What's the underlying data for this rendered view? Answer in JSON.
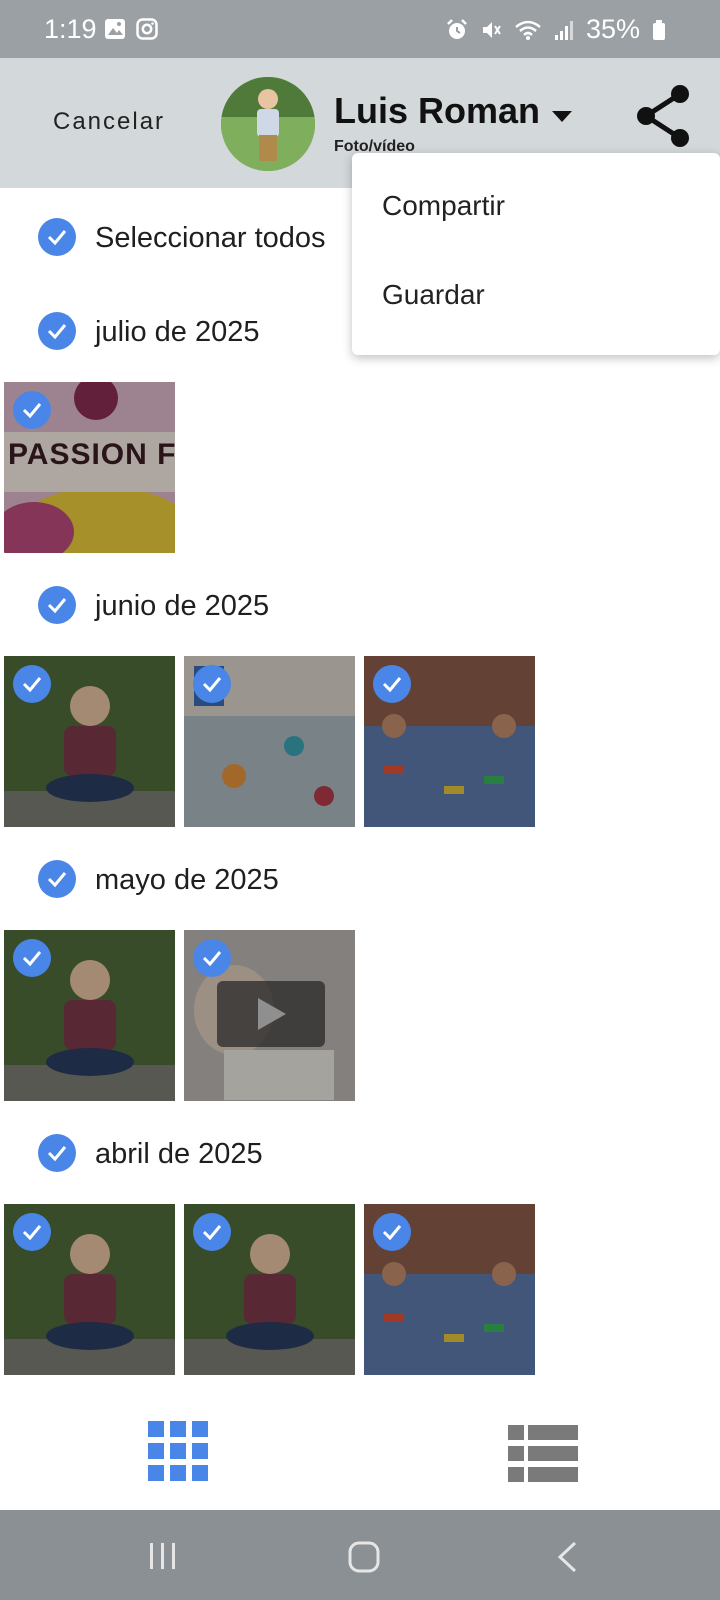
{
  "status_bar": {
    "time": "1:19",
    "battery": "35%",
    "left_icons": [
      "gallery-icon",
      "instagram-icon"
    ],
    "right_icons": [
      "alarm-icon",
      "mute-icon",
      "wifi-icon",
      "signal-icon",
      "battery-icon"
    ]
  },
  "header": {
    "cancel_label": "Cancelar",
    "name": "Luis Roman",
    "subtitle": "Foto/vídeo",
    "share_icon": "share-icon"
  },
  "select_all_label": "Seleccionar todos",
  "sections": [
    {
      "label": "julio de 2025",
      "thumbs": [
        "passion-fruit"
      ]
    },
    {
      "label": "junio de 2025",
      "thumbs": [
        "boy-portrait",
        "classroom-circle",
        "classroom-toys"
      ]
    },
    {
      "label": "mayo de 2025",
      "thumbs": [
        "boy-portrait",
        "video-baby"
      ]
    },
    {
      "label": "abril de 2025",
      "thumbs": [
        "boy-portrait",
        "boy-portrait",
        "classroom-toys"
      ]
    }
  ],
  "thumb_text": {
    "passion_fruit": "PASSION FRUIT"
  },
  "menu": {
    "items": [
      "Compartir",
      "Guardar"
    ]
  },
  "view_toggle": {
    "grid_icon": "grid-view-icon",
    "list_icon": "list-view-icon",
    "active_color": "#4a86e8",
    "inactive_color": "#7a7a7a"
  },
  "nav_bar": {
    "icons": [
      "recent-apps-icon",
      "home-icon",
      "back-icon"
    ]
  },
  "colors": {
    "accent": "#4a86e8",
    "header_bg": "#d3d8da",
    "status_bg": "#9aa0a3"
  }
}
